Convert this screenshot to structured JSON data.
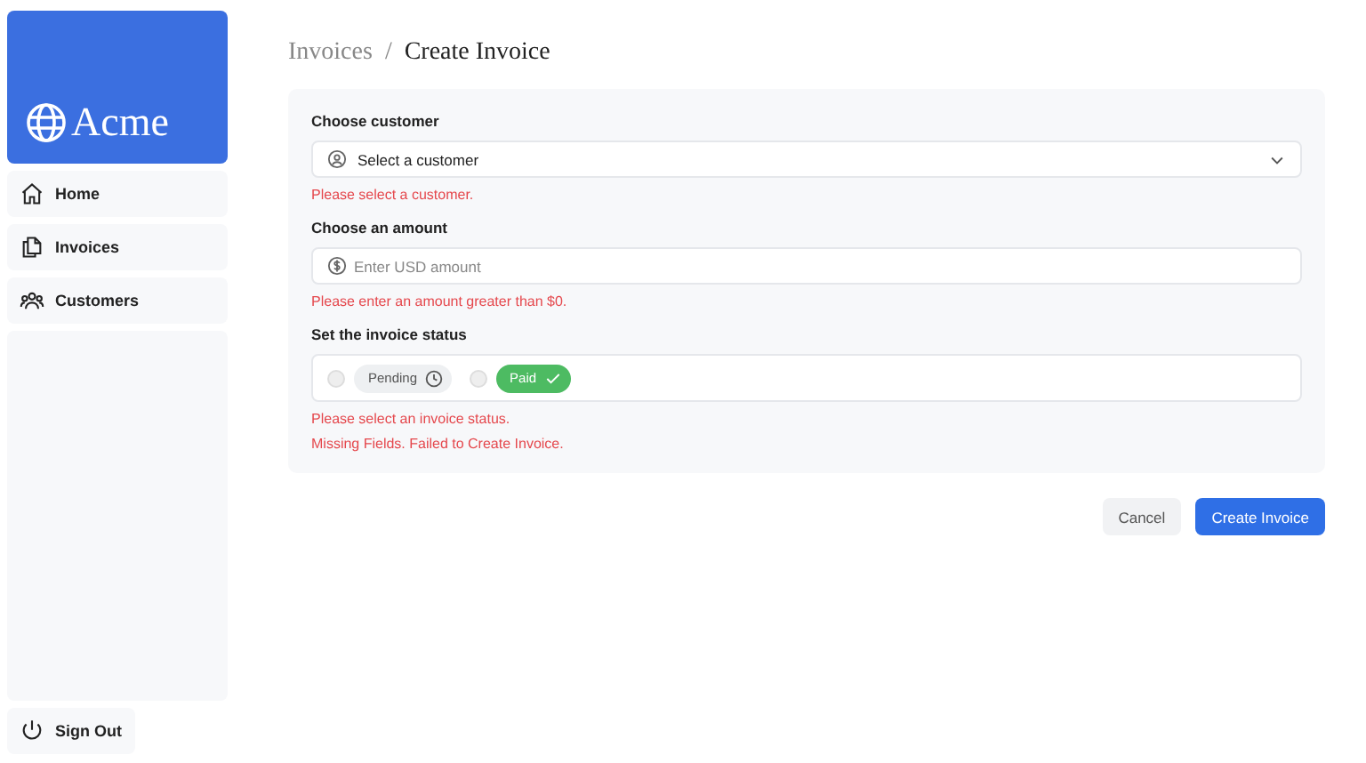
{
  "logo": {
    "text": "Acme"
  },
  "sidebar": {
    "items": [
      {
        "label": "Home",
        "kind": "home"
      },
      {
        "label": "Invoices",
        "kind": "invoices"
      },
      {
        "label": "Customers",
        "kind": "customers"
      }
    ],
    "sign_out": "Sign Out"
  },
  "breadcrumb_separator": "/",
  "breadcrumbs": [
    {
      "label": "Invoices",
      "active": false
    },
    {
      "label": "Create Invoice",
      "active": true
    }
  ],
  "form": {
    "customer": {
      "label": "Choose customer",
      "value": "Select a customer",
      "error": "Please select a customer."
    },
    "amount": {
      "label": "Choose an amount",
      "placeholder": "Enter USD amount",
      "error": "Please enter an amount greater than $0."
    },
    "status": {
      "label": "Set the invoice status",
      "options": [
        {
          "label": "Pending",
          "kind": "pending",
          "selected": false
        },
        {
          "label": "Paid",
          "kind": "paid",
          "selected": false
        }
      ],
      "error": "Please select an invoice status."
    },
    "message": "Missing Fields. Failed to Create Invoice."
  },
  "buttons": [
    {
      "label": "Cancel",
      "kind": "secondary"
    },
    {
      "label": "Create Invoice",
      "kind": "primary"
    }
  ]
}
